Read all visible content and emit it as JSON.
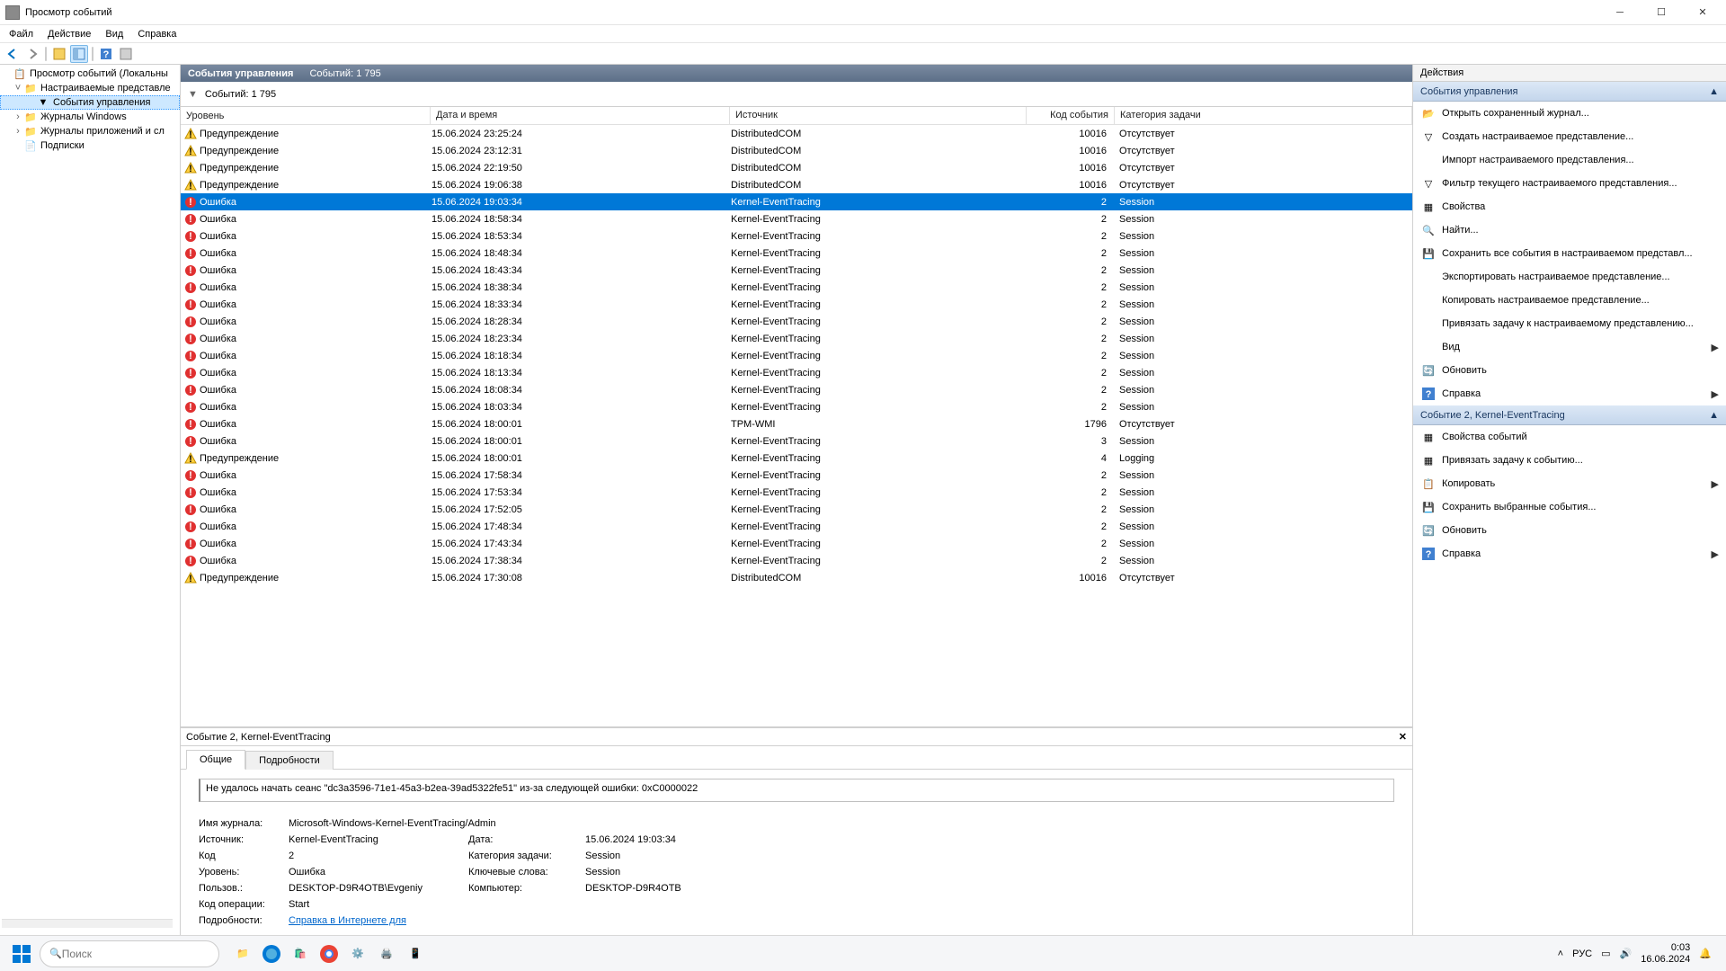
{
  "window": {
    "title": "Просмотр событий"
  },
  "menu": {
    "file": "Файл",
    "action": "Действие",
    "view": "Вид",
    "help": "Справка"
  },
  "tree": {
    "root": "Просмотр событий (Локальны",
    "custom": "Настраиваемые представле",
    "admin": "События управления",
    "winlogs": "Журналы Windows",
    "applogs": "Журналы приложений и сл",
    "subs": "Подписки"
  },
  "header": {
    "title": "События управления",
    "count_label": "Событий: 1 795"
  },
  "filter": {
    "label": "Событий: 1 795"
  },
  "cols": {
    "level": "Уровень",
    "date": "Дата и время",
    "src": "Источник",
    "id": "Код события",
    "cat": "Категория задачи"
  },
  "levels": {
    "warn": "Предупреждение",
    "err": "Ошибка"
  },
  "rows": [
    {
      "lv": "warn",
      "dt": "15.06.2024 23:25:24",
      "src": "DistributedCOM",
      "id": "10016",
      "cat": "Отсутствует"
    },
    {
      "lv": "warn",
      "dt": "15.06.2024 23:12:31",
      "src": "DistributedCOM",
      "id": "10016",
      "cat": "Отсутствует"
    },
    {
      "lv": "warn",
      "dt": "15.06.2024 22:19:50",
      "src": "DistributedCOM",
      "id": "10016",
      "cat": "Отсутствует"
    },
    {
      "lv": "warn",
      "dt": "15.06.2024 19:06:38",
      "src": "DistributedCOM",
      "id": "10016",
      "cat": "Отсутствует"
    },
    {
      "lv": "err",
      "dt": "15.06.2024 19:03:34",
      "src": "Kernel-EventTracing",
      "id": "2",
      "cat": "Session",
      "sel": true
    },
    {
      "lv": "err",
      "dt": "15.06.2024 18:58:34",
      "src": "Kernel-EventTracing",
      "id": "2",
      "cat": "Session"
    },
    {
      "lv": "err",
      "dt": "15.06.2024 18:53:34",
      "src": "Kernel-EventTracing",
      "id": "2",
      "cat": "Session"
    },
    {
      "lv": "err",
      "dt": "15.06.2024 18:48:34",
      "src": "Kernel-EventTracing",
      "id": "2",
      "cat": "Session"
    },
    {
      "lv": "err",
      "dt": "15.06.2024 18:43:34",
      "src": "Kernel-EventTracing",
      "id": "2",
      "cat": "Session"
    },
    {
      "lv": "err",
      "dt": "15.06.2024 18:38:34",
      "src": "Kernel-EventTracing",
      "id": "2",
      "cat": "Session"
    },
    {
      "lv": "err",
      "dt": "15.06.2024 18:33:34",
      "src": "Kernel-EventTracing",
      "id": "2",
      "cat": "Session"
    },
    {
      "lv": "err",
      "dt": "15.06.2024 18:28:34",
      "src": "Kernel-EventTracing",
      "id": "2",
      "cat": "Session"
    },
    {
      "lv": "err",
      "dt": "15.06.2024 18:23:34",
      "src": "Kernel-EventTracing",
      "id": "2",
      "cat": "Session"
    },
    {
      "lv": "err",
      "dt": "15.06.2024 18:18:34",
      "src": "Kernel-EventTracing",
      "id": "2",
      "cat": "Session"
    },
    {
      "lv": "err",
      "dt": "15.06.2024 18:13:34",
      "src": "Kernel-EventTracing",
      "id": "2",
      "cat": "Session"
    },
    {
      "lv": "err",
      "dt": "15.06.2024 18:08:34",
      "src": "Kernel-EventTracing",
      "id": "2",
      "cat": "Session"
    },
    {
      "lv": "err",
      "dt": "15.06.2024 18:03:34",
      "src": "Kernel-EventTracing",
      "id": "2",
      "cat": "Session"
    },
    {
      "lv": "err",
      "dt": "15.06.2024 18:00:01",
      "src": "TPM-WMI",
      "id": "1796",
      "cat": "Отсутствует"
    },
    {
      "lv": "err",
      "dt": "15.06.2024 18:00:01",
      "src": "Kernel-EventTracing",
      "id": "3",
      "cat": "Session"
    },
    {
      "lv": "warn",
      "dt": "15.06.2024 18:00:01",
      "src": "Kernel-EventTracing",
      "id": "4",
      "cat": "Logging"
    },
    {
      "lv": "err",
      "dt": "15.06.2024 17:58:34",
      "src": "Kernel-EventTracing",
      "id": "2",
      "cat": "Session"
    },
    {
      "lv": "err",
      "dt": "15.06.2024 17:53:34",
      "src": "Kernel-EventTracing",
      "id": "2",
      "cat": "Session"
    },
    {
      "lv": "err",
      "dt": "15.06.2024 17:52:05",
      "src": "Kernel-EventTracing",
      "id": "2",
      "cat": "Session"
    },
    {
      "lv": "err",
      "dt": "15.06.2024 17:48:34",
      "src": "Kernel-EventTracing",
      "id": "2",
      "cat": "Session"
    },
    {
      "lv": "err",
      "dt": "15.06.2024 17:43:34",
      "src": "Kernel-EventTracing",
      "id": "2",
      "cat": "Session"
    },
    {
      "lv": "err",
      "dt": "15.06.2024 17:38:34",
      "src": "Kernel-EventTracing",
      "id": "2",
      "cat": "Session"
    },
    {
      "lv": "warn",
      "dt": "15.06.2024 17:30:08",
      "src": "DistributedCOM",
      "id": "10016",
      "cat": "Отсутствует"
    }
  ],
  "detail": {
    "title": "Событие 2, Kernel-EventTracing",
    "tabs": {
      "general": "Общие",
      "details": "Подробности"
    },
    "msg": "Не удалось начать сеанс \"dc3a3596-71e1-45a3-b2ea-39ad5322fe51\" из-за следующей ошибки: 0xC0000022",
    "labels": {
      "log": "Имя журнала:",
      "src": "Источник:",
      "code": "Код",
      "level": "Уровень:",
      "user": "Пользов.:",
      "opcode": "Код операции:",
      "more": "Подробности:",
      "date": "Дата:",
      "cat": "Категория задачи:",
      "kw": "Ключевые слова:",
      "comp": "Компьютер:"
    },
    "values": {
      "log": "Microsoft-Windows-Kernel-EventTracing/Admin",
      "src": "Kernel-EventTracing",
      "code": "2",
      "level": "Ошибка",
      "user": "DESKTOP-D9R4OTB\\Evgeniy",
      "opcode": "Start",
      "date": "15.06.2024 19:03:34",
      "cat": "Session",
      "kw": "Session",
      "comp": "DESKTOP-D9R4OTB",
      "link": "Справка в Интернете для "
    }
  },
  "actions": {
    "header": "Действия",
    "group1": "События управления",
    "group2": "Событие 2, Kernel-EventTracing",
    "items1": [
      {
        "ic": "open",
        "t": "Открыть сохраненный журнал..."
      },
      {
        "ic": "filter",
        "t": "Создать настраиваемое представление..."
      },
      {
        "ic": "",
        "t": "Импорт настраиваемого представления..."
      },
      {
        "ic": "filter",
        "t": "Фильтр текущего настраиваемого представления..."
      },
      {
        "ic": "prop",
        "t": "Свойства"
      },
      {
        "ic": "find",
        "t": "Найти..."
      },
      {
        "ic": "save",
        "t": "Сохранить все события в настраиваемом представл..."
      },
      {
        "ic": "",
        "t": "Экспортировать настраиваемое представление..."
      },
      {
        "ic": "",
        "t": "Копировать настраиваемое представление..."
      },
      {
        "ic": "",
        "t": "Привязать задачу к настраиваемому представлению..."
      },
      {
        "ic": "",
        "t": "Вид",
        "arrow": true
      },
      {
        "ic": "refresh",
        "t": "Обновить"
      },
      {
        "ic": "help",
        "t": "Справка",
        "arrow": true
      }
    ],
    "items2": [
      {
        "ic": "prop",
        "t": "Свойства событий"
      },
      {
        "ic": "task",
        "t": "Привязать задачу к событию..."
      },
      {
        "ic": "copy",
        "t": "Копировать",
        "arrow": true
      },
      {
        "ic": "save",
        "t": "Сохранить выбранные события..."
      },
      {
        "ic": "refresh",
        "t": "Обновить"
      },
      {
        "ic": "help",
        "t": "Справка",
        "arrow": true
      }
    ]
  },
  "taskbar": {
    "search": "Поиск",
    "lang": "РУС",
    "time": "0:03",
    "date": "16.06.2024"
  }
}
